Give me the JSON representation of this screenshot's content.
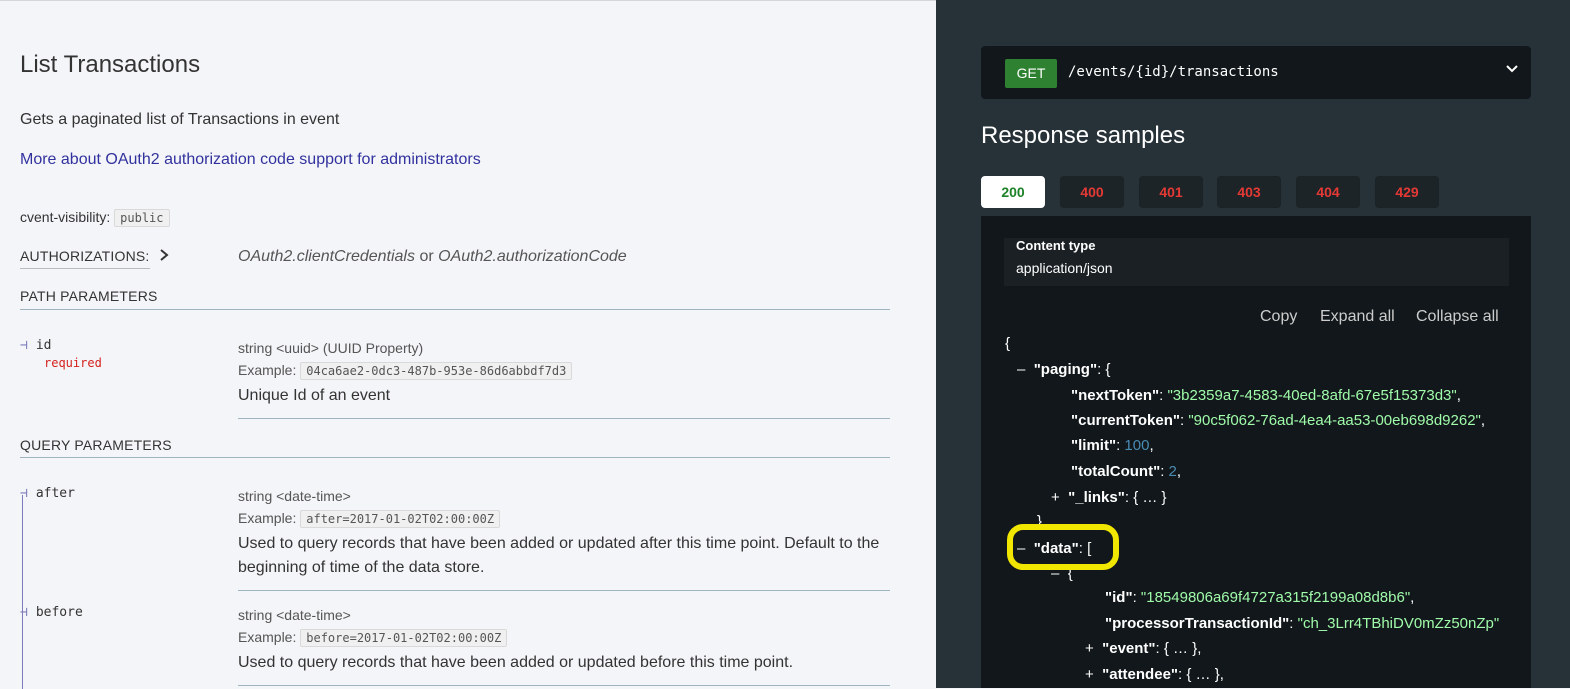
{
  "page": {
    "title": "List Transactions",
    "description": "Gets a paginated list of Transactions in event",
    "oauth_link": "More about OAuth2 authorization code support for administrators",
    "visibility_label": "cvent-visibility:",
    "visibility_value": "public"
  },
  "authorizations": {
    "label": "AUTHORIZATIONS:",
    "chevron_icon": "chevron-right-icon",
    "value1": "OAuth2.clientCredentials",
    "or": "or",
    "value2": "OAuth2.authorizationCode"
  },
  "path_params": {
    "title": "PATH PARAMETERS",
    "items": [
      {
        "name": "id",
        "required": "required",
        "type": "string <uuid> (UUID Property)",
        "example_label": "Example:",
        "example": "04ca6ae2-0dc3-487b-953e-86d6abbdf7d3",
        "description": "Unique Id of an event"
      }
    ]
  },
  "query_params": {
    "title": "QUERY PARAMETERS",
    "items": [
      {
        "name": "after",
        "type": "string <date-time>",
        "example_label": "Example:",
        "example": "after=2017-01-02T02:00:00Z",
        "description": "Used to query records that have been added or updated after this time point. Default to the beginning of time of the data store."
      },
      {
        "name": "before",
        "type": "string <date-time>",
        "example_label": "Example:",
        "example": "before=2017-01-02T02:00:00Z",
        "description": "Used to query records that have been added or updated before this time point."
      }
    ]
  },
  "endpoint": {
    "method": "GET",
    "path": "/events/{id}/transactions",
    "chevron_icon": "chevron-down-icon"
  },
  "responses": {
    "heading": "Response samples",
    "tabs": [
      "200",
      "400",
      "401",
      "403",
      "404",
      "429"
    ],
    "active_tab": "200",
    "content_type_label": "Content type",
    "content_type_value": "application/json",
    "copy_label": "Copy",
    "expand_label": "Expand all",
    "collapse_label": "Collapse all"
  },
  "json_sample": {
    "open_brace": "{",
    "paging_key": "\"paging\"",
    "next_token_key": "\"nextToken\"",
    "next_token_val": "\"3b2359a7-4583-40ed-8afd-67e5f15373d3\"",
    "current_token_key": "\"currentToken\"",
    "current_token_val": "\"90c5f062-76ad-4ea4-aa53-00eb698d9262\"",
    "limit_key": "\"limit\"",
    "limit_val": "100",
    "total_key": "\"totalCount\"",
    "total_val": "2",
    "links_key": "\"_links\"",
    "collapsed": "{ … }",
    "close_brace": "}",
    "data_key": "\"data\"",
    "open_bracket": "[",
    "id_key": "\"id\"",
    "id_val": "\"18549806a69f4727a315f2199a08d8b6\"",
    "processor_key": "\"processorTransactionId\"",
    "processor_val": "\"ch_3Lrr4TBhiDV0mZz50nZp\"",
    "event_key": "\"event\"",
    "attendee_key": "\"attendee\""
  },
  "colors": {
    "get_badge": "#2f8132",
    "active_tab_text": "#1d8127",
    "error_tab_text": "#e53935",
    "json_string": "#a0fbaa",
    "json_number": "#4a8bb3",
    "highlight": "#f0e600",
    "link": "#32329f"
  }
}
